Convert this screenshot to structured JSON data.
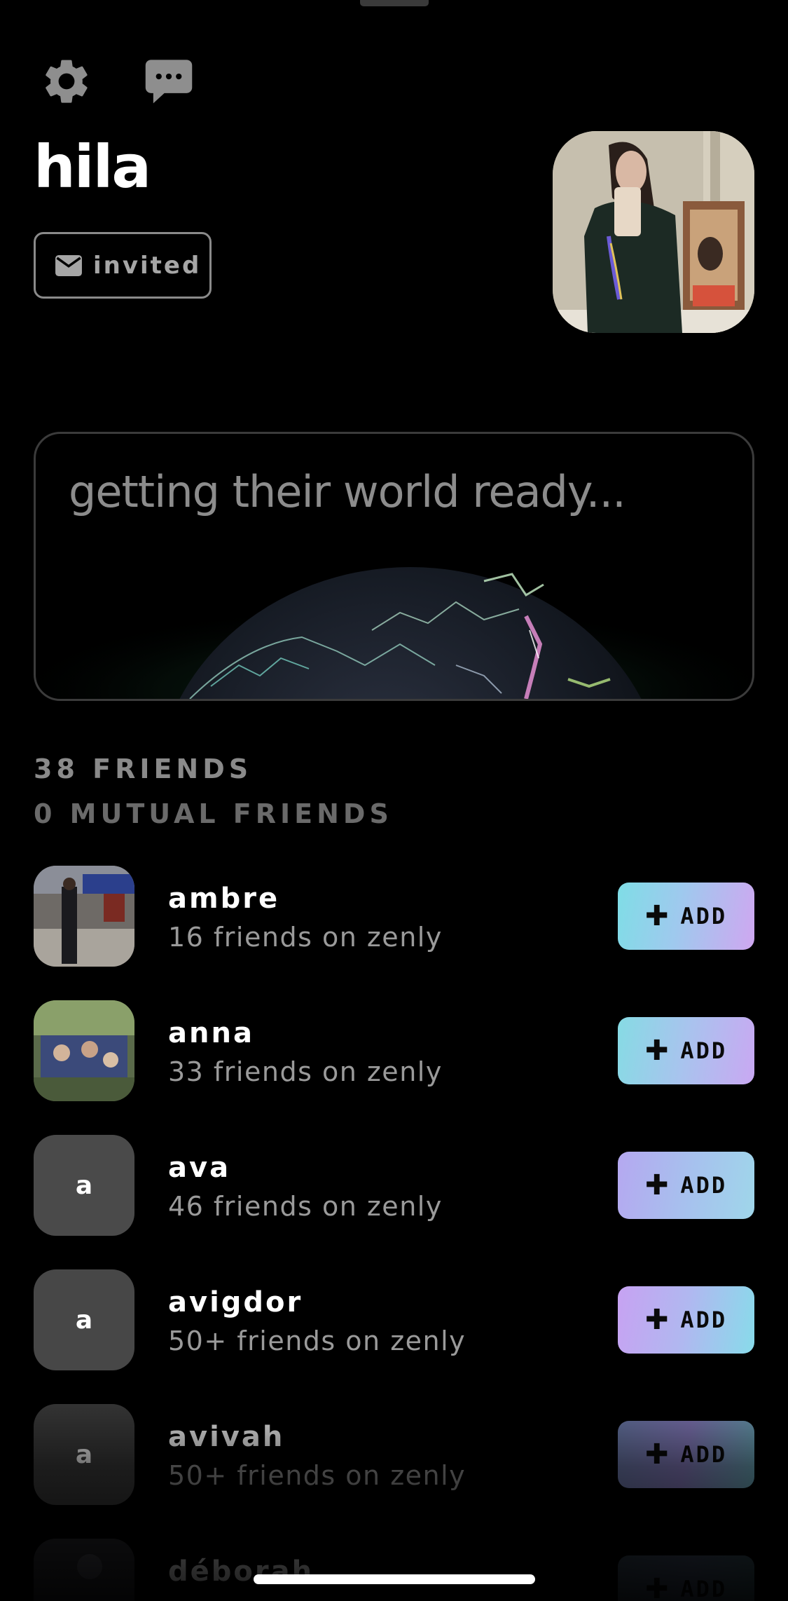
{
  "profile": {
    "name": "hila",
    "status_label": "invited"
  },
  "world_card": {
    "title": "getting their world ready..."
  },
  "counts": {
    "friends": "38 FRIENDS",
    "mutual": "0 MUTUAL FRIENDS"
  },
  "friends": [
    {
      "name": "ambre",
      "sub": "16 friends on zenly",
      "avatar": "photo",
      "add_label": "ADD"
    },
    {
      "name": "anna",
      "sub": "33 friends on zenly",
      "avatar": "photo",
      "add_label": "ADD"
    },
    {
      "name": "ava",
      "sub": "46 friends on zenly",
      "avatar_letter": "a",
      "add_label": "ADD"
    },
    {
      "name": "avigdor",
      "sub": "50+ friends on zenly",
      "avatar_letter": "a",
      "add_label": "ADD"
    },
    {
      "name": "avivah",
      "sub": "50+ friends on zenly",
      "avatar_letter": "a",
      "add_label": "ADD"
    },
    {
      "name": "déborah",
      "sub": "",
      "avatar": "photo",
      "add_label": "ADD"
    }
  ],
  "icons": {
    "settings": "gear-icon",
    "chat": "chat-bubble-icon",
    "status": "envelope-icon",
    "add": "plus-icon"
  },
  "colors": {
    "background": "#000000",
    "add_gradient_a": "#7fd8e6",
    "add_gradient_b": "#c9a6f2"
  }
}
